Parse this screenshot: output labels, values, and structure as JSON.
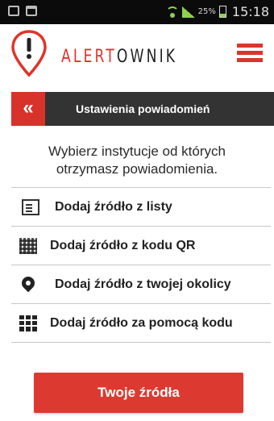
{
  "status_bar": {
    "battery_percent": "25%",
    "time": "15:18",
    "icons": [
      "image-icon",
      "briefcase-icon",
      "wifi-icon",
      "signal-icon",
      "battery-icon"
    ],
    "accent": "#8fd14f"
  },
  "header": {
    "logo_part1": "ALERT",
    "logo_part2": "OWNIK",
    "brand_color": "#e0342b",
    "menu_icon": "hamburger-menu-icon"
  },
  "subheader": {
    "back_label": "«",
    "title": "Ustawienia powiadomień"
  },
  "intro": {
    "line1": "Wybierz instytucje od których",
    "line2": "otrzymasz powiadomienia."
  },
  "items": [
    {
      "icon": "document-icon",
      "label": "Dodaj źródło z listy"
    },
    {
      "icon": "qr-code-icon",
      "label": "Dodaj źródło z kodu QR"
    },
    {
      "icon": "location-pin-icon",
      "label": "Dodaj źródło z twojej okolicy"
    },
    {
      "icon": "keypad-icon",
      "label": "Dodaj źródło za pomocą kodu"
    }
  ],
  "cta": {
    "label": "Twoje źródła"
  }
}
